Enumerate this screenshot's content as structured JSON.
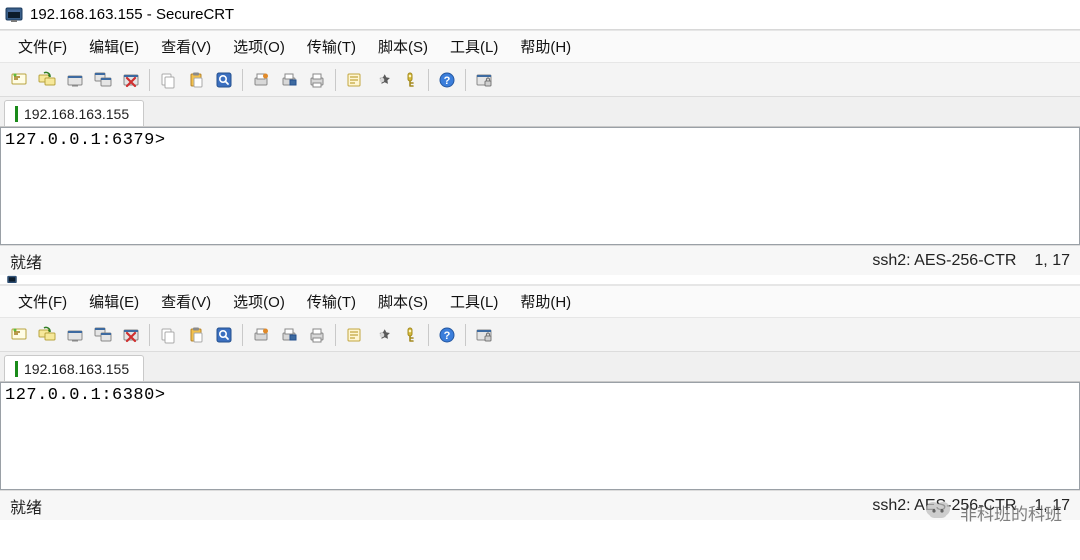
{
  "title": "192.168.163.155 - SecureCRT",
  "menu": [
    "文件(F)",
    "编辑(E)",
    "查看(V)",
    "选项(O)",
    "传输(T)",
    "脚本(S)",
    "工具(L)",
    "帮助(H)"
  ],
  "toolbar_groups": [
    [
      "quick-connect-icon",
      "reconnect-icon",
      "disconnect-icon",
      "sessions-icon",
      "disconnect-all-icon"
    ],
    [
      "copy-icon",
      "paste-icon",
      "find-icon"
    ],
    [
      "print-setup-icon",
      "print-screen-icon",
      "print-icon"
    ],
    [
      "properties-icon",
      "options-icon",
      "keymap-icon"
    ],
    [
      "help-icon"
    ],
    [
      "lock-session-icon"
    ]
  ],
  "instances": [
    {
      "tab_label": "192.168.163.155",
      "terminal_line": "127.0.0.1:6379>",
      "status_left": "就绪",
      "status_conn": "ssh2: AES-256-CTR",
      "status_pos": "1,  17"
    },
    {
      "tab_label": "192.168.163.155",
      "terminal_line": "127.0.0.1:6380>",
      "status_left": "就绪",
      "status_conn": "ssh2: AES-256-CTR",
      "status_pos": "1,  17"
    }
  ],
  "watermark_text": "非科班的科班"
}
